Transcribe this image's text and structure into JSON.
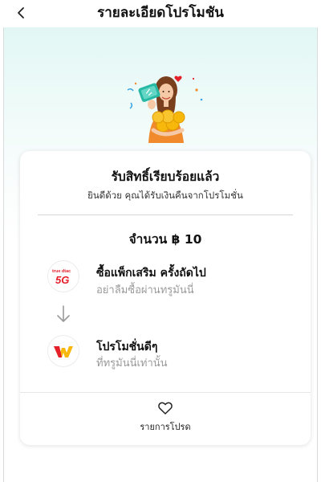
{
  "header": {
    "title": "รายละเอียดโปรโมชัน"
  },
  "card": {
    "title": "รับสิทธิ์เรียบร้อยแล้ว",
    "subtitle": "ยินดีด้วย คุณได้รับเงินคืนจากโปรโมชั่น",
    "amount": "จำนวน ฿ 10",
    "steps": [
      {
        "title": "ซื้อแพ็กเสริม ครั้งถัดไป",
        "subtitle": "อย่าลืมซื้อผ่านทรูมันนี่",
        "logo_text": "5G",
        "logo_brand": "true dtac"
      },
      {
        "title": "โปรโมชั่นดีๆ",
        "subtitle": "ที่ทรูมันนี่เท่านั้น"
      }
    ],
    "favorite_label": "รายการโปรด"
  },
  "colors": {
    "accent_red": "#e4202b",
    "hero_bg": "#e2f7f5",
    "logo_yellow": "#f7b80b",
    "muted_text": "#9a9a9a"
  }
}
